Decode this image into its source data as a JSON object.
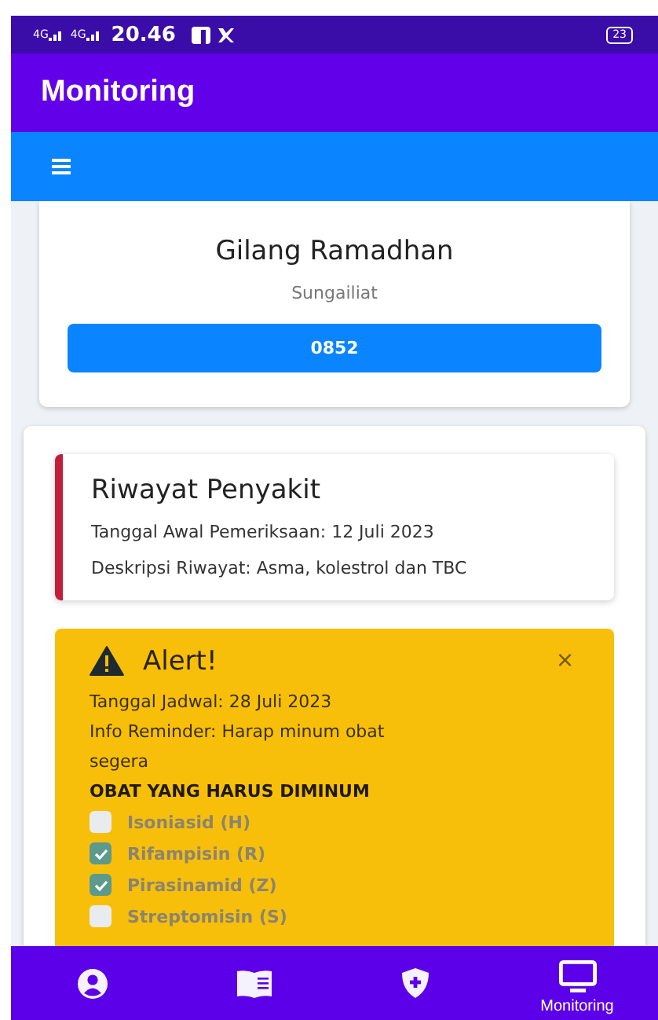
{
  "status_bar": {
    "networks": [
      "4G",
      "4G"
    ],
    "time": "20.46",
    "battery": "23"
  },
  "app_bar": {
    "title": "Monitoring"
  },
  "profile": {
    "name": "Gilang Ramadhan",
    "location": "Sungailiat",
    "phone": "0852"
  },
  "history": {
    "title": "Riwayat Penyakit",
    "lines": [
      "Tanggal Awal Pemeriksaan: 12 Juli 2023",
      "Deskripsi Riwayat: Asma, kolestrol dan TBC"
    ]
  },
  "alert": {
    "title": "Alert!",
    "close": "×",
    "lines": [
      "Tanggal Jadwal: 28 Juli 2023",
      "Info Reminder: Harap minum obat segera"
    ],
    "heading": "OBAT YANG HARUS DIMINUM",
    "medicines": [
      {
        "label": "Isoniasid (H)",
        "checked": false
      },
      {
        "label": "Rifampisin (R)",
        "checked": true
      },
      {
        "label": "Pirasinamid (Z)",
        "checked": true
      },
      {
        "label": "Streptomisin (S)",
        "checked": false
      }
    ]
  },
  "bottom_nav": [
    {
      "selected": false
    },
    {
      "selected": false
    },
    {
      "selected": false
    },
    {
      "label": "Monitoring",
      "selected": true
    }
  ]
}
